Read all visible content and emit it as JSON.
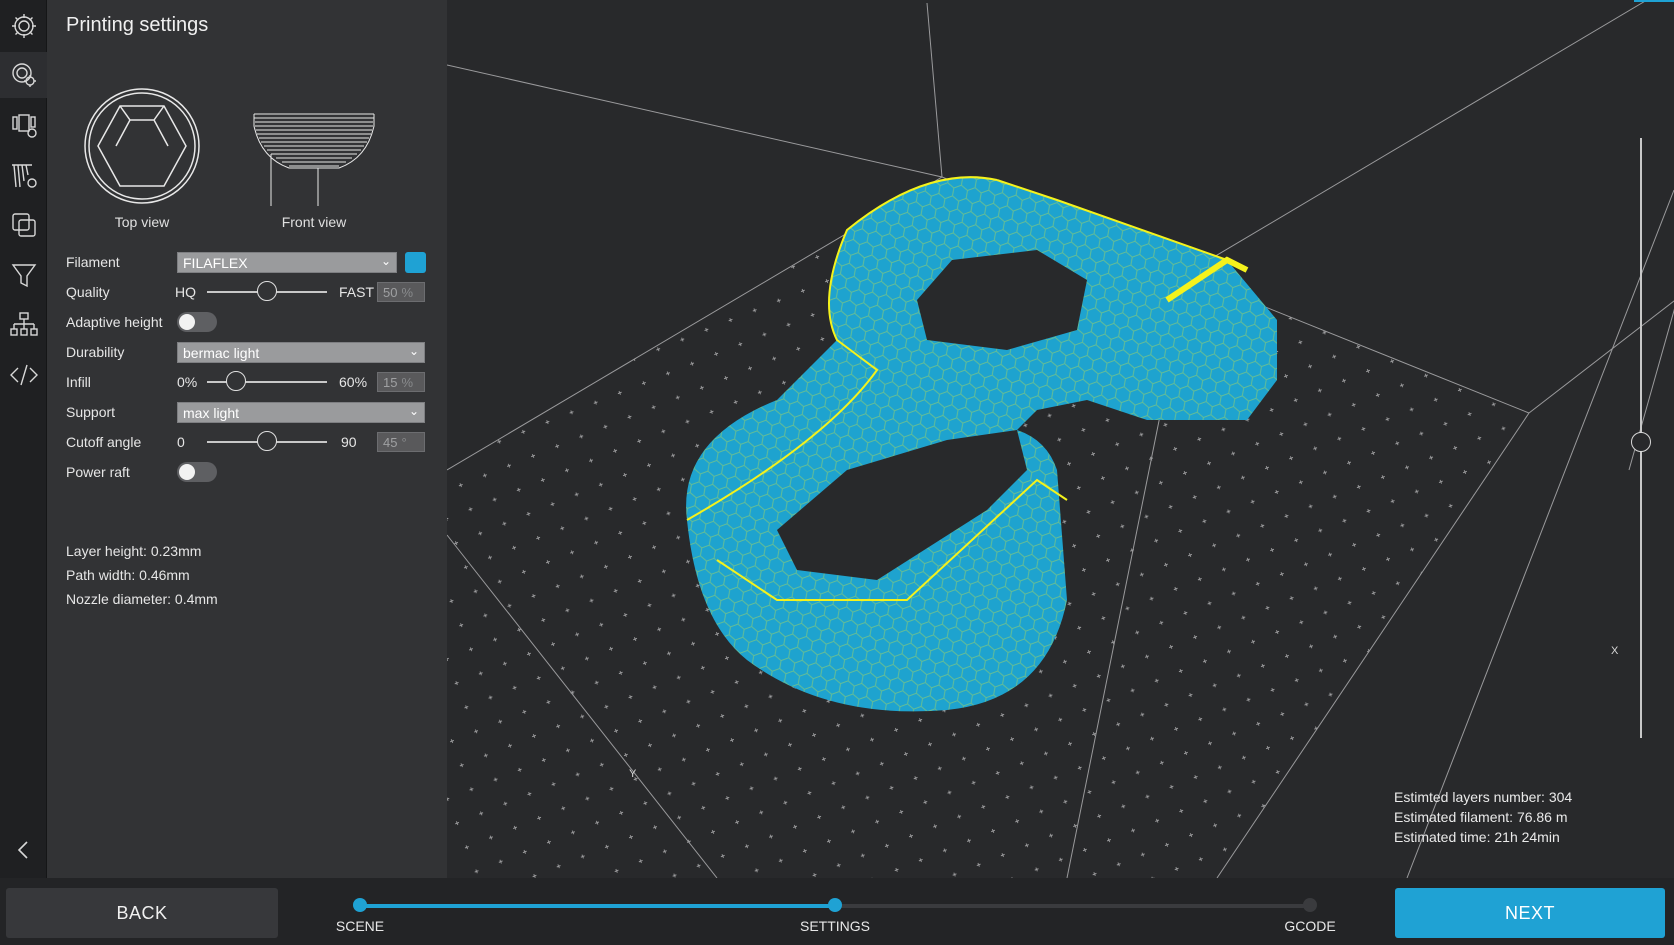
{
  "panel": {
    "title": "Printing settings"
  },
  "views": {
    "top_label": "Top view",
    "front_label": "Front view"
  },
  "settings": {
    "filament": {
      "label": "Filament",
      "value": "FILAFLEX",
      "color": "#1fa2d4"
    },
    "quality": {
      "label": "Quality",
      "min": "HQ",
      "max": "FAST",
      "value": "50",
      "unit": "%",
      "level": 0.5
    },
    "adaptive_height": {
      "label": "Adaptive height",
      "on": false
    },
    "durability": {
      "label": "Durability",
      "value": "bermac light"
    },
    "infill": {
      "label": "Infill",
      "min": "0%",
      "max": "60%",
      "value": "15",
      "unit": "%",
      "level": 0.25
    },
    "support": {
      "label": "Support",
      "value": "max light"
    },
    "cutoff_angle": {
      "label": "Cutoff angle",
      "min": "0",
      "max": "90",
      "value": "45",
      "unit": "°",
      "level": 0.5
    },
    "power_raft": {
      "label": "Power raft",
      "on": false
    }
  },
  "info": {
    "layer_height": "Layer height: 0.23mm",
    "path_width": "Path width: 0.46mm",
    "nozzle_diameter": "Nozzle diameter: 0.4mm"
  },
  "estimates": {
    "layers": "Estimted layers number: 304",
    "filament": "Estimated filament: 76.86 m",
    "time": "Estimated time: 21h 24min"
  },
  "axes": {
    "x": "X",
    "y": "Y"
  },
  "nav": {
    "back": "BACK",
    "next": "NEXT",
    "steps": [
      "SCENE",
      "SETTINGS",
      "GCODE"
    ],
    "current_step": 1
  },
  "colors": {
    "accent": "#1fa2d4",
    "model": "#1ea3cf",
    "toolpath": "#f4f21c"
  },
  "sidebar_icons": [
    "settings-gear-icon",
    "printing-settings-icon",
    "printer-settings-icon",
    "support-settings-icon",
    "layers-icon",
    "filter-icon",
    "tree-icon",
    "code-icon"
  ]
}
